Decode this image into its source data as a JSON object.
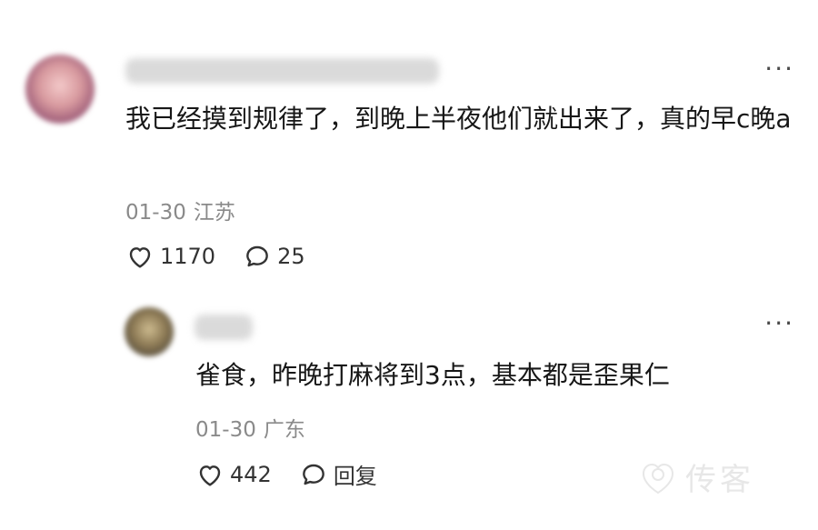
{
  "comments": [
    {
      "text": "我已经摸到规律了，到晚上半夜他们就出来了，真的早c晚a",
      "date": "01-30",
      "location": "江苏",
      "likes": "1170",
      "replies": "25",
      "more": "···"
    },
    {
      "text": "雀食，昨晚打麻将到3点，基本都是歪果仁",
      "date": "01-30",
      "location": "广东",
      "likes": "442",
      "reply_label": "回复",
      "more": "···"
    }
  ],
  "watermark": {
    "text": "传客"
  }
}
